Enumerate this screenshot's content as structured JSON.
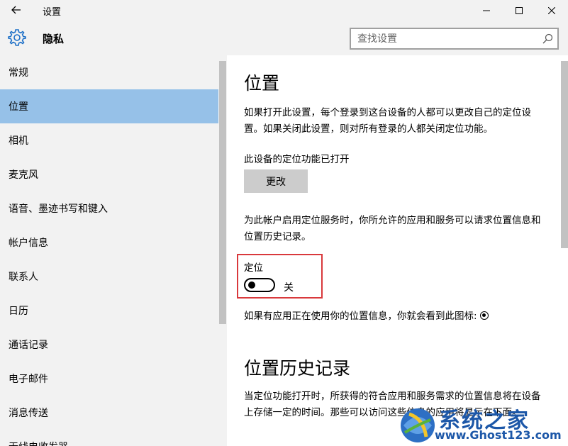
{
  "window": {
    "title": "设置"
  },
  "header": {
    "title": "隐私",
    "search_placeholder": "查找设置"
  },
  "sidebar": {
    "items": [
      {
        "label": "常规"
      },
      {
        "label": "位置",
        "selected": true
      },
      {
        "label": "相机"
      },
      {
        "label": "麦克风"
      },
      {
        "label": "语音、墨迹书写和键入"
      },
      {
        "label": "帐户信息"
      },
      {
        "label": "联系人"
      },
      {
        "label": "日历"
      },
      {
        "label": "通话记录"
      },
      {
        "label": "电子邮件"
      },
      {
        "label": "消息传送"
      },
      {
        "label": "无线电收发器"
      }
    ]
  },
  "content": {
    "title": "位置",
    "intro": "如果打开此设置，每个登录到这台设备的人都可以更改自己的定位设置。如果关闭此设置，则对所有登录的人都关闭定位功能。",
    "device_status": "此设备的定位功能已打开",
    "change_button": "更改",
    "account_desc": "为此帐户启用定位服务时，你所允许的应用和服务可以请求位置信息和位置历史记录。",
    "location_label": "定位",
    "location_toggle": {
      "state": "关",
      "on": false
    },
    "icon_note": "如果有应用正在使用你的位置信息，你就会看到此图标:",
    "history_title": "位置历史记录",
    "history_desc": "当定位功能打开时，所获得的符合应用和服务需求的位置信息将在设备上存储一定的时间。那些可以访问这些信息的应用将显示在下面。"
  },
  "watermark": {
    "title": "系统之家",
    "url": "www.Ghost123.com"
  },
  "colors": {
    "selected_nav": "#96c1e8",
    "highlight_border": "#d9393c",
    "chrome_bg": "#f2f2f2",
    "button_bg": "#cccccc"
  }
}
